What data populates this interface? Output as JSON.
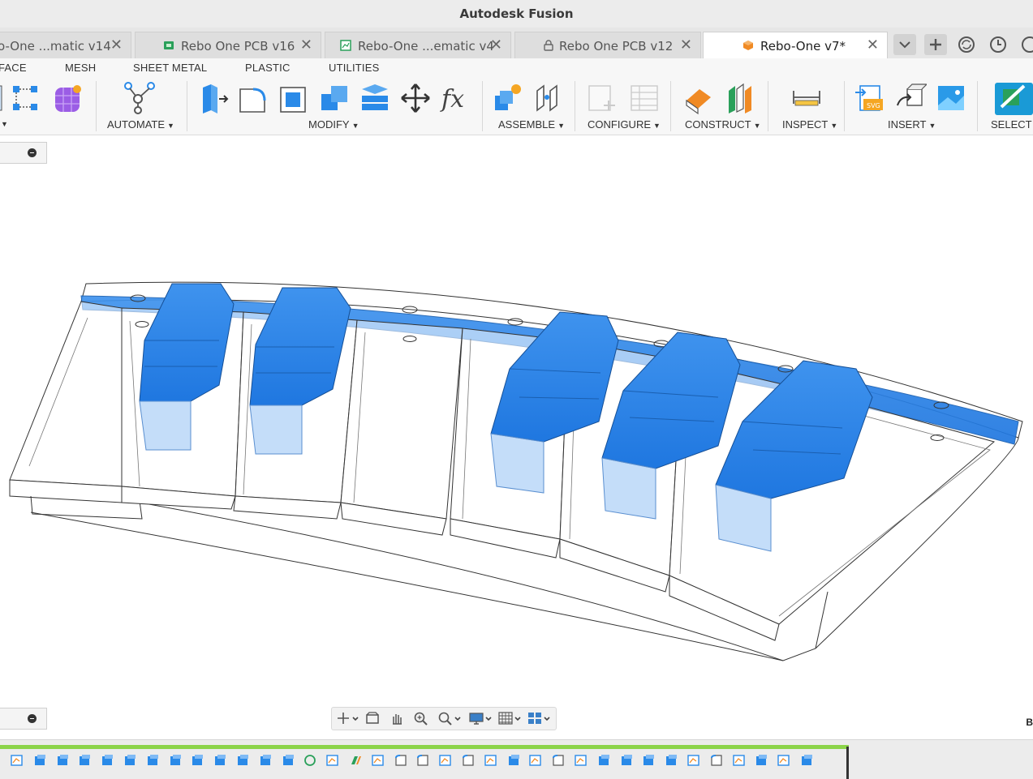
{
  "window": {
    "title": "Autodesk Fusion"
  },
  "tabs": [
    {
      "label": "o-One ...matic v14",
      "icon": "schematic-icon",
      "active": false
    },
    {
      "label": "Rebo One PCB v16",
      "icon": "pcb-icon",
      "active": false
    },
    {
      "label": "Rebo-One ...ematic v4",
      "icon": "schematic-icon",
      "active": false
    },
    {
      "label": "Rebo One PCB v12",
      "icon": "lock-icon",
      "active": false
    },
    {
      "label": "Rebo-One v7*",
      "icon": "component-icon",
      "active": true
    }
  ],
  "tab_close_glyph": "✕",
  "toolbar_categories": [
    "FACE",
    "MESH",
    "SHEET METAL",
    "PLASTIC",
    "UTILITIES"
  ],
  "toolbar_groups": [
    "AUTOMATE",
    "MODIFY",
    "ASSEMBLE",
    "CONFIGURE",
    "CONSTRUCT",
    "INSPECT",
    "INSERT",
    "SELECT"
  ],
  "viewport_corner_label": "B",
  "colors": {
    "accent_blue": "#1a7ae6",
    "timeline_green": "#8cd44a",
    "toolbar_bg": "#f7f7f7"
  }
}
